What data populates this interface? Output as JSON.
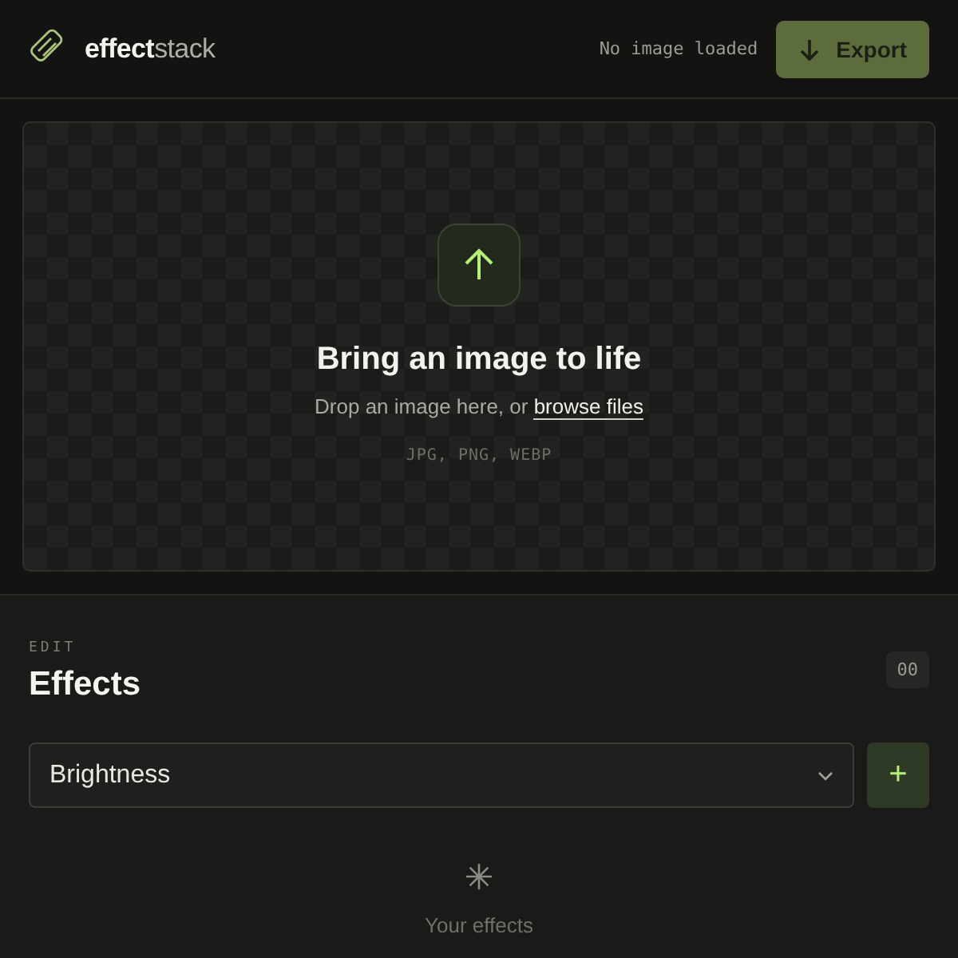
{
  "header": {
    "logo": "**effect**stack",
    "status": "No image loaded",
    "export_button": "Export"
  },
  "dropzone": {
    "title": "Bring an image to life",
    "hint": "Drop an image here, or ",
    "link": "browse files",
    "formats": "JPG, PNG, WEBP"
  },
  "effects": {
    "eyebrow": "EDIT",
    "title": "Effects",
    "count": "00",
    "select": {
      "value": "Brightness"
    },
    "add_button": "+",
    "empty_text": "Your effects"
  }
}
